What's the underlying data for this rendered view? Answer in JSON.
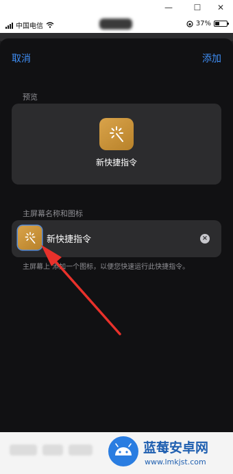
{
  "window": {
    "minimize": "—",
    "maximize": "☐",
    "close": "✕"
  },
  "status": {
    "carrier": "中国电信",
    "battery": "37%"
  },
  "nav": {
    "cancel": "取消",
    "add": "添加"
  },
  "preview": {
    "section": "预览",
    "shortcut_name": "新快捷指令"
  },
  "home_screen": {
    "section": "主屏幕名称和图标",
    "name_value": "新快捷指令",
    "description": "主屏幕上 添加一个图标，以便您快速运行此快捷指令。"
  },
  "watermark": {
    "title": "蓝莓安卓网",
    "url": "www.lmkjst.com"
  },
  "colors": {
    "accent": "#3f8ef5",
    "icon": "#d39d43",
    "arrow": "#e8312b"
  }
}
